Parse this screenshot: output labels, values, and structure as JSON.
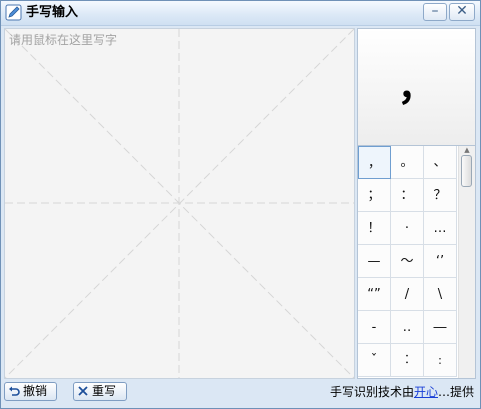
{
  "window": {
    "title": "手写输入"
  },
  "titlebar": {
    "minimize_label": "–",
    "close_label": "✕"
  },
  "canvas": {
    "placeholder": "请用鼠标在这里写字"
  },
  "preview": {
    "character": "，"
  },
  "candidates": [
    [
      "，",
      "。",
      "、"
    ],
    [
      "；",
      "：",
      "？"
    ],
    [
      "！",
      "·",
      "…"
    ],
    [
      "—",
      "～",
      "‘’"
    ],
    [
      "“”",
      "/",
      "\\"
    ],
    [
      "‑",
      "‥",
      "―"
    ],
    [
      "ˇ",
      "︰",
      "﹕"
    ]
  ],
  "toolbar": {
    "undo_label": "撤销",
    "clear_label": "重写"
  },
  "footer": {
    "credit_prefix": "手写识别技术由",
    "credit_link": "开心",
    "credit_suffix": "…提供"
  },
  "colors": {
    "accent": "#1a3fd6",
    "window_bg": "#dbe7f4"
  }
}
